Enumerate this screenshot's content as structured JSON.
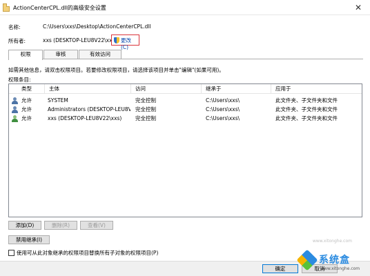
{
  "window": {
    "title": "ActionCenterCPL.dll的高级安全设置",
    "close_glyph": "✕"
  },
  "fields": {
    "name_label": "名称:",
    "name_value": "C:\\Users\\xxs\\Desktop\\ActionCenterCPL.dll",
    "owner_label": "所有者:",
    "owner_value": "xxs (DESKTOP-LEU8V22\\xxs)",
    "change_link": "更改(C)"
  },
  "tabs": [
    {
      "label": "权限",
      "active": true
    },
    {
      "label": "审核",
      "active": false
    },
    {
      "label": "有效访问",
      "active": false
    }
  ],
  "info_text": "如需其他信息，请双击权限项目。若要修改权限项目，请选择该项目并单击\"编辑\"(如果可用)。",
  "entries_label": "权限条目:",
  "table": {
    "headers": [
      "类型",
      "主体",
      "访问",
      "继承于",
      "应用于"
    ],
    "rows": [
      {
        "type": "允许",
        "principal": "SYSTEM",
        "access": "完全控制",
        "inherited": "C:\\Users\\xxs\\",
        "applies": "此文件夹、子文件夹和文件",
        "icon": "group-user-icon"
      },
      {
        "type": "允许",
        "principal": "Administrators (DESKTOP-LEU8V...",
        "access": "完全控制",
        "inherited": "C:\\Users\\xxs\\",
        "applies": "此文件夹、子文件夹和文件",
        "icon": "group-user-icon"
      },
      {
        "type": "允许",
        "principal": "xxs (DESKTOP-LEU8V22\\xxs)",
        "access": "完全控制",
        "inherited": "C:\\Users\\xxs\\",
        "applies": "此文件夹、子文件夹和文件",
        "icon": "user-icon"
      }
    ]
  },
  "buttons": {
    "add": "添加(D)",
    "remove": "删除(R)",
    "view": "查看(V)",
    "disable_inheritance": "禁用继承(I)",
    "ok": "确定",
    "cancel": "取消"
  },
  "checkbox_label": "使用可从此对象继承的权限项目替换所有子对象的权限项目(P)",
  "watermark": {
    "brand": "系统盒",
    "url": "www.xitonghe.com",
    "side_text": "www.xitonghe.com"
  },
  "colors": {
    "highlight_border": "#d9333a",
    "link": "#0645ad",
    "ok_border": "#0078d7"
  }
}
